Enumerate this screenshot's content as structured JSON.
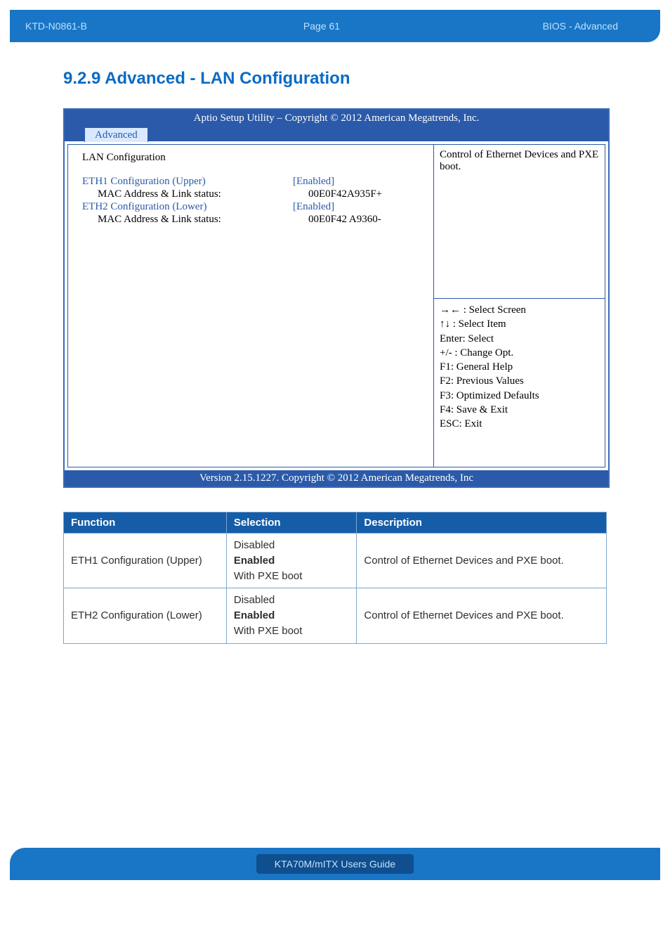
{
  "header": {
    "doc_id": "KTD-N0861-B",
    "page_label": "Page 61",
    "section": "BIOS  - Advanced"
  },
  "section_title": "9.2.9  Advanced  -  LAN Configuration",
  "bios": {
    "top_title": "Aptio Setup Utility  –  Copyright © 2012 American Megatrends, Inc.",
    "tab": "Advanced",
    "left": {
      "title": "LAN Configuration",
      "rows": [
        {
          "type": "link_sel",
          "label": "ETH1 Configuration (Upper)",
          "value": "[Enabled]"
        },
        {
          "type": "plain",
          "label": "MAC Address & Link status:",
          "value": "00E0F42A935F+"
        },
        {
          "type": "link",
          "label": "ETH2 Configuration (Lower)",
          "value": "[Enabled]"
        },
        {
          "type": "plain",
          "label": "MAC Address & Link status:",
          "value": "00E0F42 A9360-"
        }
      ]
    },
    "right": {
      "help_top": "Control of Ethernet Devices and PXE boot.",
      "keys": [
        "→← : Select Screen",
        "↑↓ : Select Item",
        "Enter: Select",
        "+/- : Change Opt.",
        "F1: General Help",
        "F2: Previous Values",
        "F3: Optimized Defaults",
        "F4: Save & Exit",
        "ESC: Exit"
      ]
    },
    "bottom": "Version 2.15.1227. Copyright © 2012 American Megatrends, Inc"
  },
  "table": {
    "headers": {
      "c0": "Function",
      "c1": "Selection",
      "c2": "Description"
    },
    "rows": [
      {
        "func": "ETH1 Configuration (Upper)",
        "sel": {
          "a": "Disabled",
          "b": "Enabled",
          "c": "With PXE boot"
        },
        "desc": "Control of Ethernet Devices and PXE boot."
      },
      {
        "func": "ETH2 Configuration (Lower)",
        "sel": {
          "a": "Disabled",
          "b": "Enabled",
          "c": "With PXE boot"
        },
        "desc": "Control of Ethernet Devices and PXE boot."
      }
    ]
  },
  "footer": "KTA70M/mITX Users Guide"
}
